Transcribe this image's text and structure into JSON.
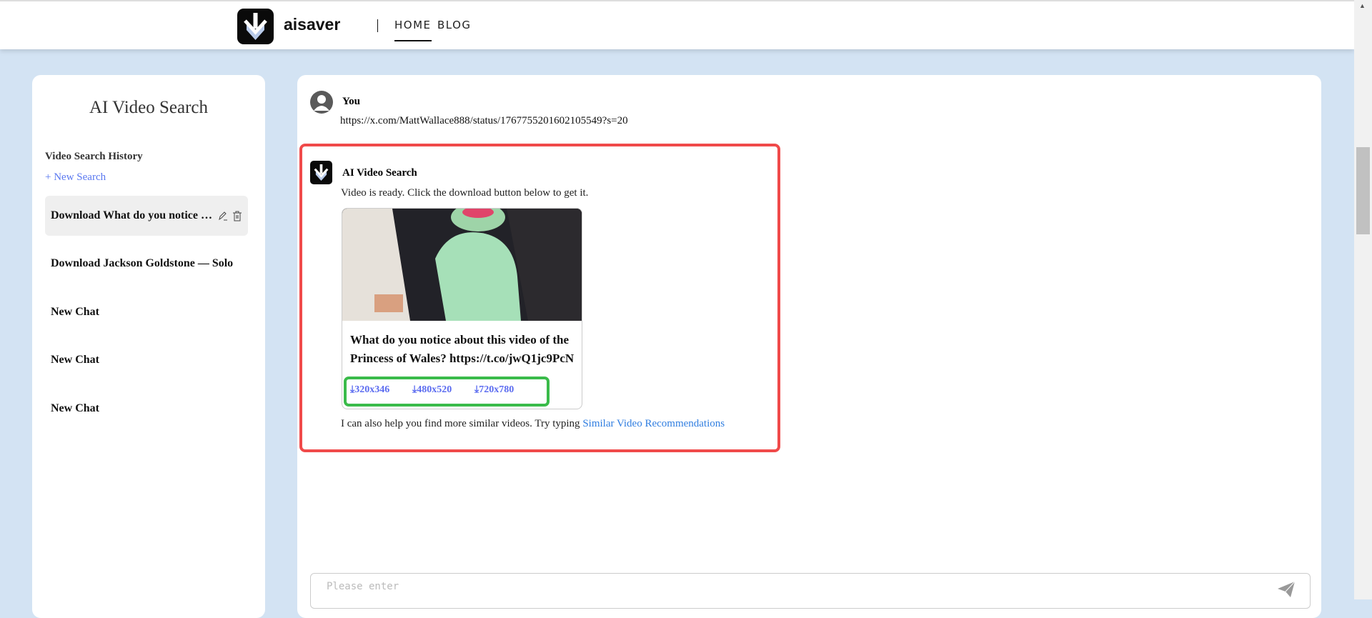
{
  "header": {
    "brand": "aisaver",
    "nav": [
      {
        "label": "HOME",
        "active": true
      },
      {
        "label": "BLOG",
        "active": false
      }
    ]
  },
  "sidebar": {
    "title": "AI Video Search",
    "history_label": "Video Search History",
    "new_search": "New Search",
    "items": [
      {
        "label": "Download What do you notice about this video of the Princess of Wales?",
        "active": true
      },
      {
        "label": "Download Jackson Goldstone — Solo"
      },
      {
        "label": "New Chat"
      },
      {
        "label": "New Chat"
      },
      {
        "label": "New Chat"
      }
    ]
  },
  "chat": {
    "user": {
      "name": "You",
      "message": "https://x.com/MattWallace888/status/1767755201602105549?s=20"
    },
    "bot": {
      "name": "AI Video Search",
      "ready": "Video is ready. Click the download button below to get it.",
      "video_title": "What do you notice about this video of the Princess of Wales? https://t.co/jwQ1jc9PcN",
      "downloads": [
        "320x346",
        "480x520",
        "720x780"
      ],
      "followup": "I can also help you find more similar videos. Try typing ",
      "followup_link": "Similar Video Recommendations"
    }
  },
  "input": {
    "placeholder": "Please enter"
  },
  "colors": {
    "accent": "#5b6cf0",
    "highlight_red": "#f04a4a",
    "highlight_green": "#3abb4a",
    "background": "#d3e3f3"
  }
}
